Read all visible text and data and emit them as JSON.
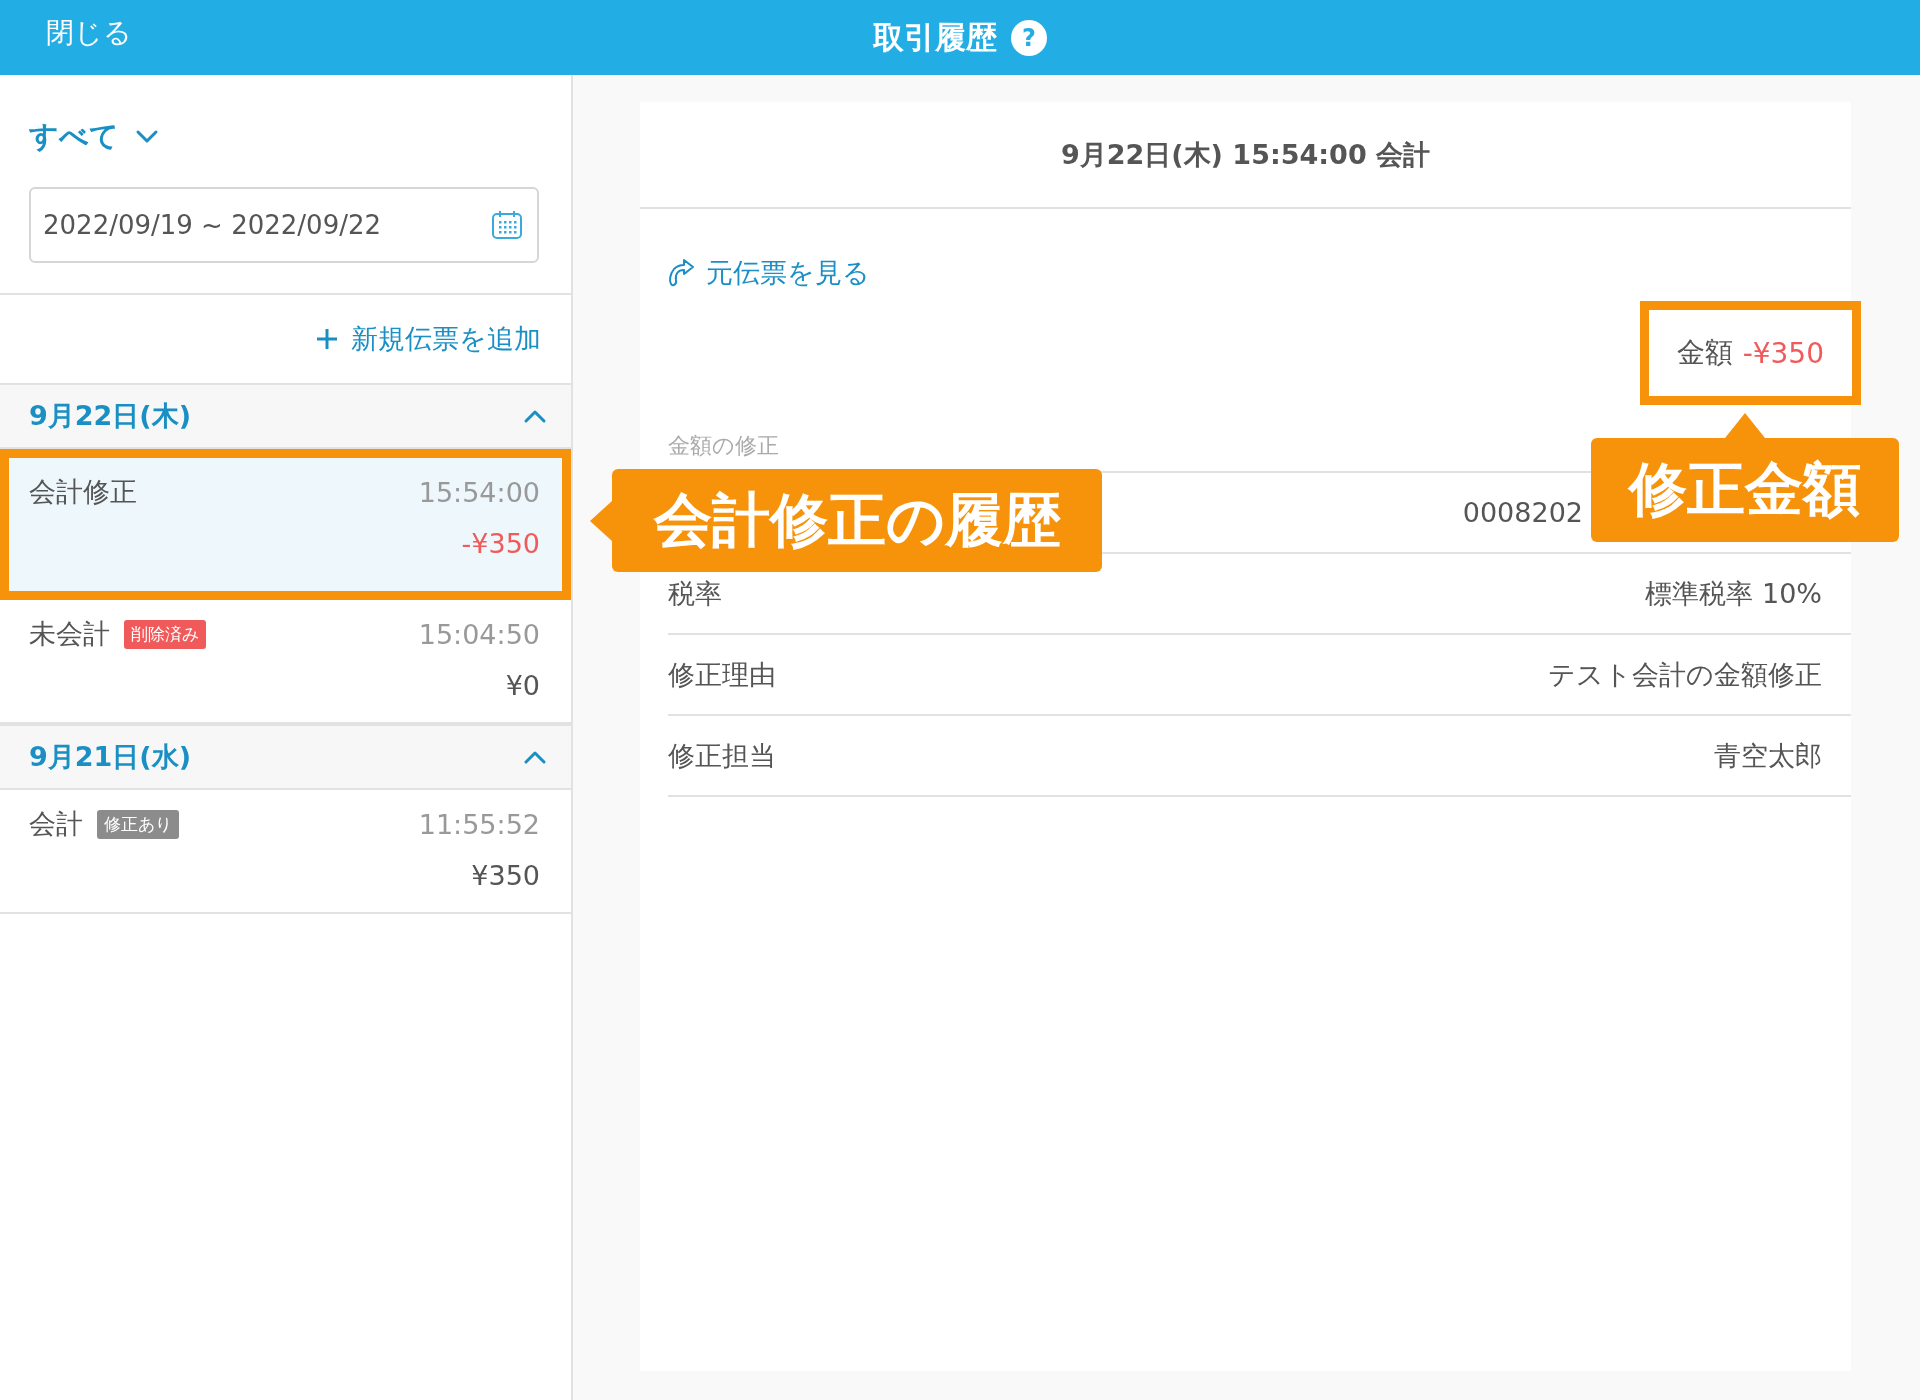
{
  "header": {
    "close": "閉じる",
    "title": "取引履歴",
    "help": "?"
  },
  "sidebar": {
    "filter": "すべて",
    "date_range": "2022/09/19 ~ 2022/09/22",
    "add_button": "新規伝票を追加",
    "groups": [
      {
        "date": "9月22日(木)",
        "expanded": true,
        "items": [
          {
            "label": "会計修正",
            "time": "15:54:00",
            "amount": "-¥350",
            "negative": true,
            "selected": true
          },
          {
            "label": "未会計",
            "tag": "削除済み",
            "color": "#f05a5a",
            "time": "15:04:50",
            "amount": "¥0",
            "negative": false,
            "selected": false
          }
        ]
      },
      {
        "date": "9月21日(水)",
        "expanded": true,
        "items": [
          {
            "label": "会計",
            "tag": "修正あり",
            "color": "#8c8c8c",
            "time": "11:55:52",
            "amount": "¥350",
            "negative": false,
            "selected": false
          }
        ]
      }
    ]
  },
  "detail": {
    "title": "9月22日(木) 15:54:00 会計",
    "link": "元伝票を見る",
    "amount_label": "金額",
    "amount": "-¥350",
    "section": "金額の修正",
    "rows": [
      {
        "value": "0008202"
      },
      {
        "label": "税率",
        "value": "標準税率 10%"
      },
      {
        "label": "修正理由",
        "value": "テスト会計の金額修正"
      },
      {
        "label": "修正担当",
        "value": "青空太郎"
      }
    ]
  },
  "annotations": [
    {
      "text": "会計修正の履歴",
      "kind": "left"
    },
    {
      "text": "修正金額",
      "kind": "up"
    }
  ]
}
